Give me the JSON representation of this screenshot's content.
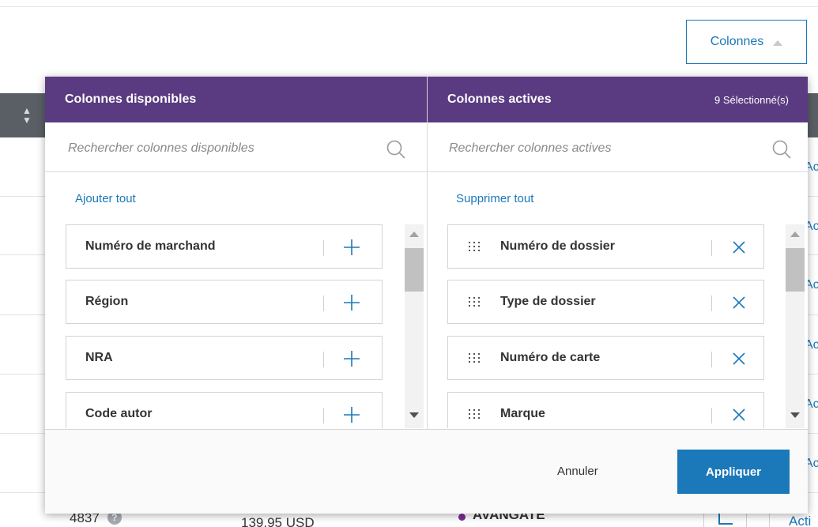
{
  "toolbar": {
    "columns_button_label": "Colonnes"
  },
  "background_table": {
    "right_link_text": "Actions",
    "bottom_row": {
      "id": "4837",
      "help_badge": "?",
      "amount": "139.95 USD",
      "status": "AVANGATE",
      "action_link": "Acti"
    }
  },
  "available_panel": {
    "title": "Colonnes disponibles",
    "search_placeholder": "Rechercher colonnes disponibles",
    "bulk_action": "Ajouter tout",
    "items": [
      {
        "label": "Numéro de marchand"
      },
      {
        "label": "Région"
      },
      {
        "label": "NRA"
      },
      {
        "label": "Code autor"
      }
    ]
  },
  "active_panel": {
    "title": "Colonnes actives",
    "selected_count": "9 Sélectionné(s)",
    "search_placeholder": "Rechercher colonnes actives",
    "bulk_action": "Supprimer tout",
    "items": [
      {
        "label": "Numéro de dossier"
      },
      {
        "label": "Type de dossier"
      },
      {
        "label": "Numéro de carte"
      },
      {
        "label": "Marque"
      }
    ]
  },
  "footer": {
    "cancel_label": "Annuler",
    "apply_label": "Appliquer"
  },
  "colors": {
    "header_purple": "#5a3a80",
    "accent_blue": "#1b78b9",
    "table_header_gray": "#5a5f66"
  },
  "icons": {
    "add": "plus-icon",
    "remove": "close-icon",
    "drag": "drag-handle-icon",
    "search": "search-icon",
    "columns_toggle": "caret-up-icon",
    "sort": "sort-icon",
    "edit": "edit-icon",
    "help": "help-icon"
  }
}
